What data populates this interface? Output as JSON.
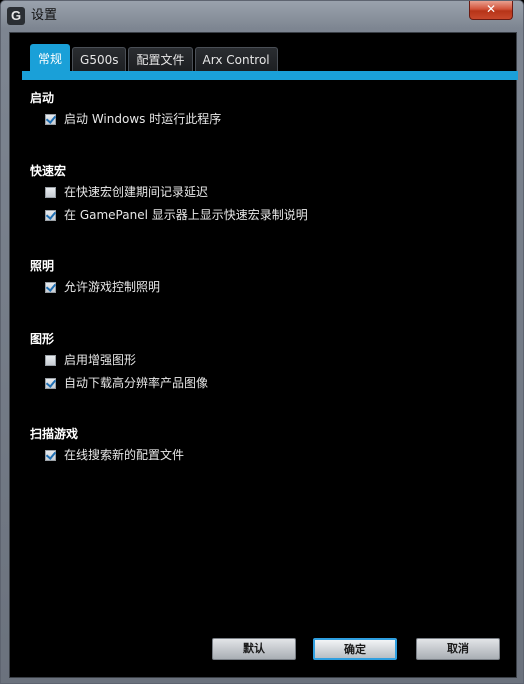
{
  "window": {
    "title": "设置",
    "close_glyph": "✕",
    "app_icon_glyph": "G"
  },
  "tabs": [
    {
      "label": "常规",
      "active": true
    },
    {
      "label": "G500s",
      "active": false
    },
    {
      "label": "配置文件",
      "active": false
    },
    {
      "label": "Arx Control",
      "active": false
    }
  ],
  "sections": {
    "startup": {
      "title": "启动",
      "options": [
        {
          "label": "启动 Windows 时运行此程序",
          "checked": true
        }
      ]
    },
    "macros": {
      "title": "快速宏",
      "options": [
        {
          "label": "在快速宏创建期间记录延迟",
          "checked": false
        },
        {
          "label": "在 GamePanel 显示器上显示快速宏录制说明",
          "checked": true
        }
      ]
    },
    "lighting": {
      "title": "照明",
      "options": [
        {
          "label": "允许游戏控制照明",
          "checked": true
        }
      ]
    },
    "graphics": {
      "title": "图形",
      "options": [
        {
          "label": "启用增强图形",
          "checked": false
        },
        {
          "label": "自动下载高分辨率产品图像",
          "checked": true
        }
      ]
    },
    "scan": {
      "title": "扫描游戏",
      "options": [
        {
          "label": "在线搜索新的配置文件",
          "checked": true
        }
      ]
    }
  },
  "buttons": {
    "default_label": "默认",
    "ok_label": "确定",
    "cancel_label": "取消"
  },
  "colors": {
    "accent": "#1aa0d8",
    "client_bg": "#000000",
    "frame": "#7d8591"
  }
}
